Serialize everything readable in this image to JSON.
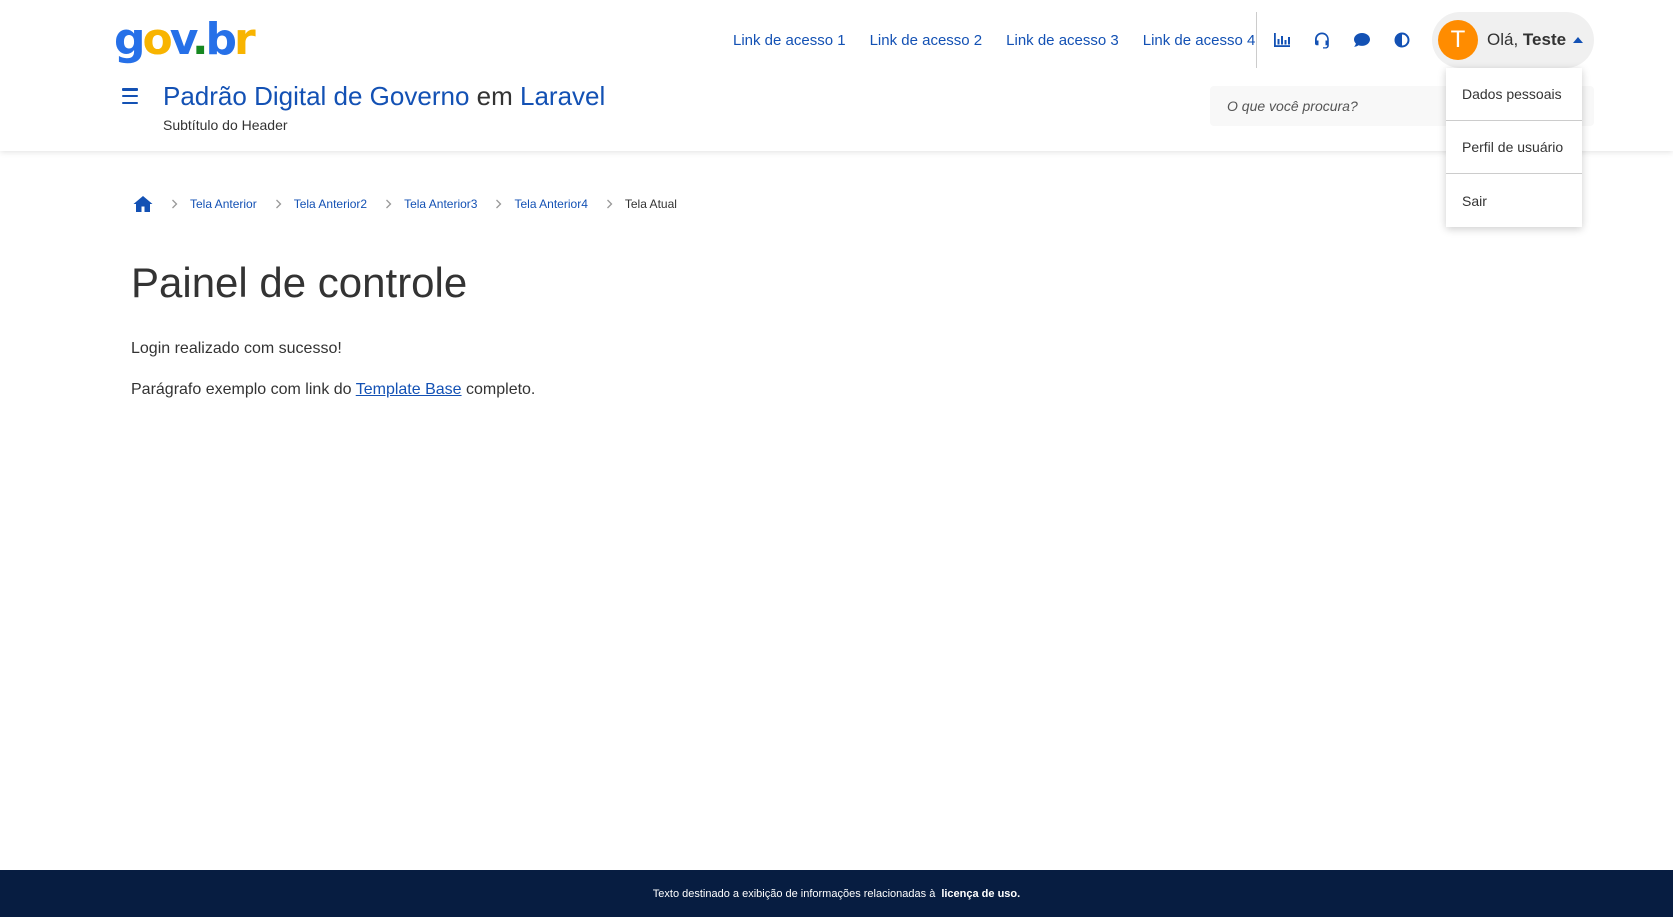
{
  "header": {
    "logo": {
      "g": "g",
      "o": "o",
      "v": "v",
      "dot": ".",
      "b": "b",
      "r": "r"
    },
    "access_links": [
      "Link de acesso 1",
      "Link de acesso 2",
      "Link de acesso 3",
      "Link de acesso 4"
    ],
    "functions": [
      "chart-icon",
      "headset-icon",
      "chat-icon",
      "contrast-icon"
    ],
    "title_part1": "Padrão Digital de Governo",
    "title_em": " em ",
    "title_part2": "Laravel",
    "subtitle": "Subtítulo do Header",
    "search_placeholder": "O que você procura?",
    "user": {
      "avatar_letter": "T",
      "greeting": "Olá, ",
      "name": "Teste"
    }
  },
  "user_menu": {
    "items": [
      "Dados pessoais",
      "Perfil de usuário",
      "Sair"
    ]
  },
  "breadcrumb": {
    "items": [
      "Tela Anterior",
      "Tela Anterior2",
      "Tela Anterior3",
      "Tela Anterior4"
    ],
    "current": "Tela Atual"
  },
  "main": {
    "title": "Painel de controle",
    "message": "Login realizado com sucesso!",
    "paragraph_before": "Parágrafo exemplo com link do ",
    "paragraph_link": "Template Base",
    "paragraph_after": " completo."
  },
  "footer": {
    "text": "Texto destinado a exibição de informações relacionadas à",
    "link": "licença de uso."
  },
  "colors": {
    "primary": "#1351b4",
    "footer_bg": "#071d41",
    "avatar_bg": "#ff8c00"
  }
}
